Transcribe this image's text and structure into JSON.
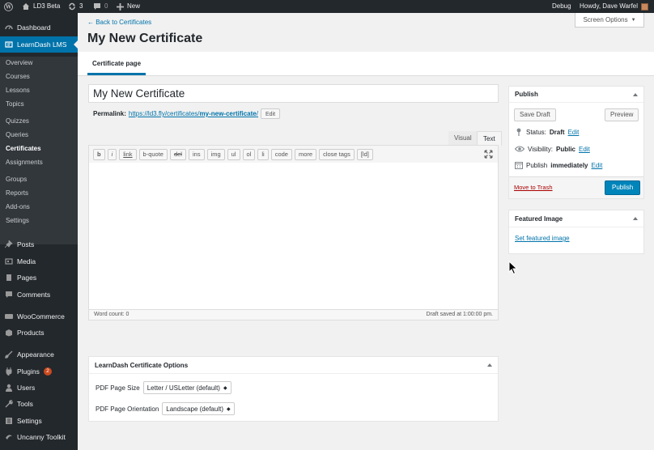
{
  "adminbar": {
    "site_name": "LD3 Beta",
    "updates_count": "3",
    "comments_count": "0",
    "new_label": "New",
    "debug_label": "Debug",
    "howdy_label": "Howdy, Dave Warfel"
  },
  "sidebar": {
    "dashboard": "Dashboard",
    "learndash": "LearnDash LMS",
    "submenu": [
      "Overview",
      "Courses",
      "Lessons",
      "Topics",
      "Quizzes",
      "Queries",
      "Certificates",
      "Assignments",
      "Groups",
      "Reports",
      "Add-ons",
      "Settings"
    ],
    "posts": "Posts",
    "media": "Media",
    "pages": "Pages",
    "comments": "Comments",
    "woocommerce": "WooCommerce",
    "products": "Products",
    "appearance": "Appearance",
    "plugins": "Plugins",
    "plugins_badge": "2",
    "users": "Users",
    "tools": "Tools",
    "settings": "Settings",
    "uncanny": "Uncanny Toolkit"
  },
  "header": {
    "back_link": "← Back to Certificates",
    "page_title": "My New Certificate",
    "screen_options": "Screen Options"
  },
  "tabs": {
    "certificate_page": "Certificate page"
  },
  "editor": {
    "title_value": "My New Certificate",
    "permalink_label": "Permalink:",
    "permalink_base": "https://ld3.fly/certificates/",
    "permalink_slug": "my-new-certificate",
    "permalink_end": "/",
    "edit_label": "Edit",
    "tab_visual": "Visual",
    "tab_text": "Text",
    "quicktags": [
      "b",
      "i",
      "link",
      "b-quote",
      "del",
      "ins",
      "img",
      "ul",
      "ol",
      "li",
      "code",
      "more",
      "close tags",
      "[ld]"
    ],
    "word_count": "Word count: 0",
    "draft_saved": "Draft saved at 1:00:00 pm."
  },
  "publish": {
    "title": "Publish",
    "save_draft": "Save Draft",
    "preview": "Preview",
    "status_label": "Status:",
    "status_value": "Draft",
    "visibility_label": "Visibility:",
    "visibility_value": "Public",
    "publish_label": "Publish",
    "publish_value": "immediately",
    "edit_link": "Edit",
    "move_to_trash": "Move to Trash",
    "publish_button": "Publish"
  },
  "featured": {
    "title": "Featured Image",
    "set_link": "Set featured image"
  },
  "ld_options": {
    "title": "LearnDash Certificate Options",
    "page_size_label": "PDF Page Size",
    "page_size_value": "Letter / USLetter (default)",
    "orientation_label": "PDF Page Orientation",
    "orientation_value": "Landscape (default)"
  },
  "colors": {
    "accent": "#0073aa",
    "sidebar_bg": "#23282d",
    "publish_button": "#0085ba",
    "trash": "#a00000"
  }
}
